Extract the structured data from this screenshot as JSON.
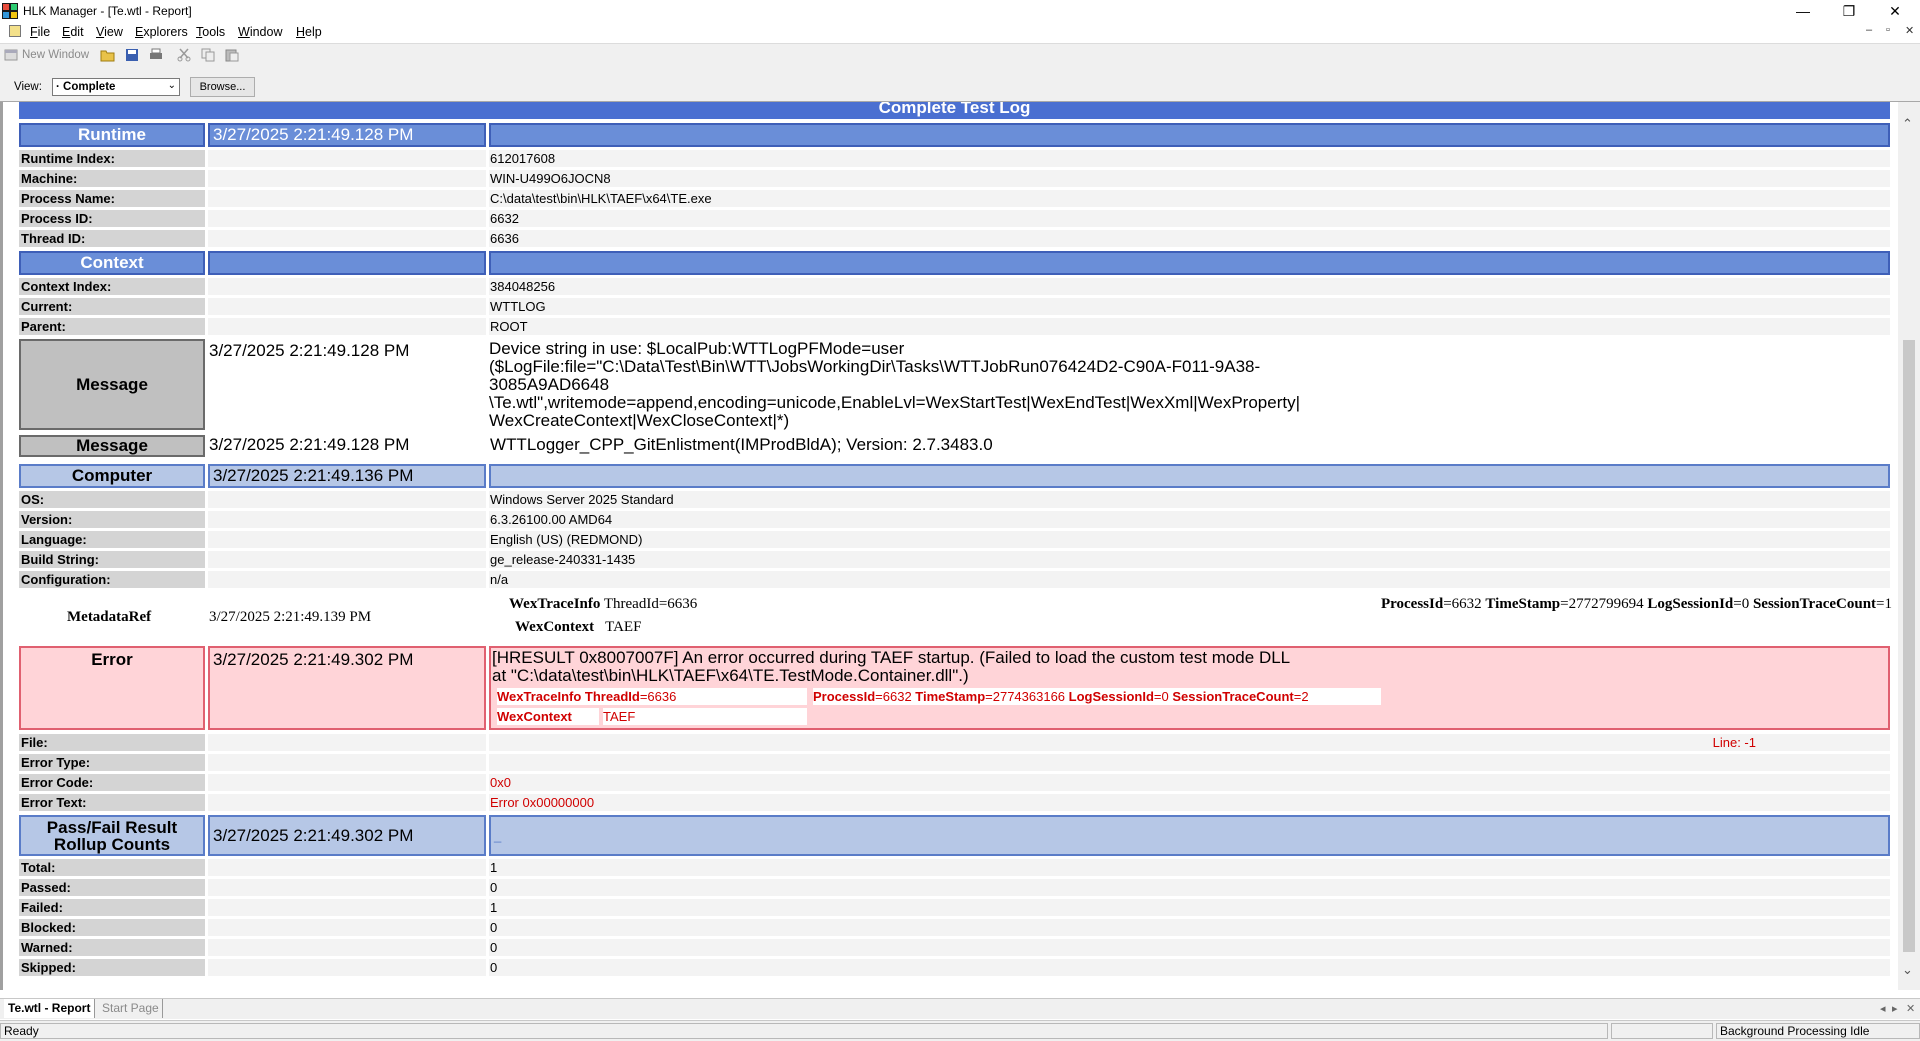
{
  "window": {
    "title": "HLK Manager - [Te.wtl - Report]",
    "minimize": "—",
    "restore": "❐",
    "close": "✕"
  },
  "menu": {
    "items": [
      {
        "label": "File",
        "u": "F",
        "rest": "ile"
      },
      {
        "label": "Edit",
        "u": "E",
        "rest": "dit"
      },
      {
        "label": "View",
        "u": "V",
        "rest": "iew"
      },
      {
        "label": "Explorers",
        "u": "E",
        "rest": "xplorers"
      },
      {
        "label": "Tools",
        "u": "T",
        "rest": "ools"
      },
      {
        "label": "Window",
        "u": "W",
        "rest": "indow"
      },
      {
        "label": "Help",
        "u": "H",
        "rest": "elp"
      }
    ],
    "mdi_min": "–",
    "mdi_restore": "▫",
    "mdi_close": "✕"
  },
  "toolbar": {
    "new_window": "New Window"
  },
  "viewbar": {
    "label": "View:",
    "selected": "· Complete",
    "browse": "Browse..."
  },
  "report": {
    "title": "Complete Test Log",
    "runtime": {
      "label": "Runtime",
      "time": "3/27/2025 2:21:49.128 PM",
      "rows": [
        {
          "k": "Runtime Index:",
          "v": "612017608"
        },
        {
          "k": "Machine:",
          "v": "WIN-U499O6JOCN8"
        },
        {
          "k": "Process Name:",
          "v": "C:\\data\\test\\bin\\HLK\\TAEF\\x64\\TE.exe"
        },
        {
          "k": "Process ID:",
          "v": "6632"
        },
        {
          "k": "Thread ID:",
          "v": "6636"
        }
      ]
    },
    "context": {
      "label": "Context",
      "rows": [
        {
          "k": "Context Index:",
          "v": "384048256"
        },
        {
          "k": "Current:",
          "v": "WTTLOG"
        },
        {
          "k": "Parent:",
          "v": "ROOT"
        }
      ]
    },
    "message1": {
      "label": "Message",
      "time": "3/27/2025 2:21:49.128 PM",
      "lines": [
        "Device string in use: $LocalPub:WTTLogPFMode=user",
        "($LogFile:file=\"C:\\Data\\Test\\Bin\\WTT\\JobsWorkingDir\\Tasks\\WTTJobRun076424D2-C90A-F011-9A38-",
        "3085A9AD6648",
        "\\Te.wtl\",writemode=append,encoding=unicode,EnableLvl=WexStartTest|WexEndTest|WexXml|WexProperty|",
        "WexCreateContext|WexCloseContext|*)"
      ]
    },
    "message2": {
      "label": "Message",
      "time": "3/27/2025 2:21:49.128 PM",
      "text": "WTTLogger_CPP_GitEnlistment(IMProdBldA); Version: 2.7.3483.0"
    },
    "computer": {
      "label": "Computer",
      "time": "3/27/2025 2:21:49.136 PM",
      "rows": [
        {
          "k": "OS:",
          "v": "Windows Server 2025 Standard"
        },
        {
          "k": "Version:",
          "v": "6.3.26100.00 AMD64"
        },
        {
          "k": "Language:",
          "v": "English (US) (REDMOND)"
        },
        {
          "k": "Build String:",
          "v": "ge_release-240331-1435"
        },
        {
          "k": "Configuration:",
          "v": "n/a"
        }
      ]
    },
    "metadata": {
      "label": "MetadataRef",
      "time": "3/27/2025 2:21:49.139 PM",
      "trace_key": "WexTraceInfo",
      "thread": "ThreadId=6636",
      "ctx_key": "WexContext",
      "ctx_val": "TAEF",
      "pid_key": "ProcessId",
      "pid_val": "=6632",
      "ts_key": "TimeStamp",
      "ts_val": "=2772799694",
      "ls_key": "LogSessionId",
      "ls_val": "=0",
      "stc_key": "SessionTraceCount",
      "stc_val": "=1"
    },
    "error": {
      "label": "Error",
      "time": "3/27/2025 2:21:49.302 PM",
      "line1": "[HRESULT 0x8007007F] An error occurred during TAEF startup. (Failed to load the custom test mode DLL",
      "line2": "at \"C:\\data\\test\\bin\\HLK\\TAEF\\x64\\TE.TestMode.Container.dll\".)",
      "trace_key": "WexTraceInfo",
      "tid_key": "ThreadId",
      "tid_val": "=6636",
      "pid_key": "ProcessId",
      "pid_val": "=6632",
      "ts_key": "TimeStamp",
      "ts_val": "=2774363166",
      "ls_key": "LogSessionId",
      "ls_val": "=0",
      "stc_key": "SessionTraceCount",
      "stc_val": "=2",
      "ctx_key": "WexContext",
      "ctx_val": "TAEF",
      "rows": [
        {
          "k": "File:",
          "v": ""
        },
        {
          "k": "Error Type:",
          "v": ""
        },
        {
          "k": "Error Code:",
          "v": "0x0"
        },
        {
          "k": "Error Text:",
          "v": "Error 0x00000000"
        }
      ],
      "line_info": "Line: -1"
    },
    "rollup": {
      "label_line1": "Pass/Fail Result",
      "label_line2": "Rollup Counts",
      "time": "3/27/2025 2:21:49.302 PM",
      "marker": "_",
      "rows": [
        {
          "k": "Total:",
          "v": "1"
        },
        {
          "k": "Passed:",
          "v": "0"
        },
        {
          "k": "Failed:",
          "v": "1"
        },
        {
          "k": "Blocked:",
          "v": "0"
        },
        {
          "k": "Warned:",
          "v": "0"
        },
        {
          "k": "Skipped:",
          "v": "0"
        }
      ]
    }
  },
  "tabs": {
    "active": "Te.wtl - Report",
    "other": "Start Page"
  },
  "status": {
    "left": "Ready",
    "right": "Background Processing Idle"
  },
  "colors": {
    "header_blue": "#6a8ed8",
    "light_blue": "#b6c7e6",
    "error_pink": "#ffd4d8",
    "error_red": "#d00000"
  }
}
